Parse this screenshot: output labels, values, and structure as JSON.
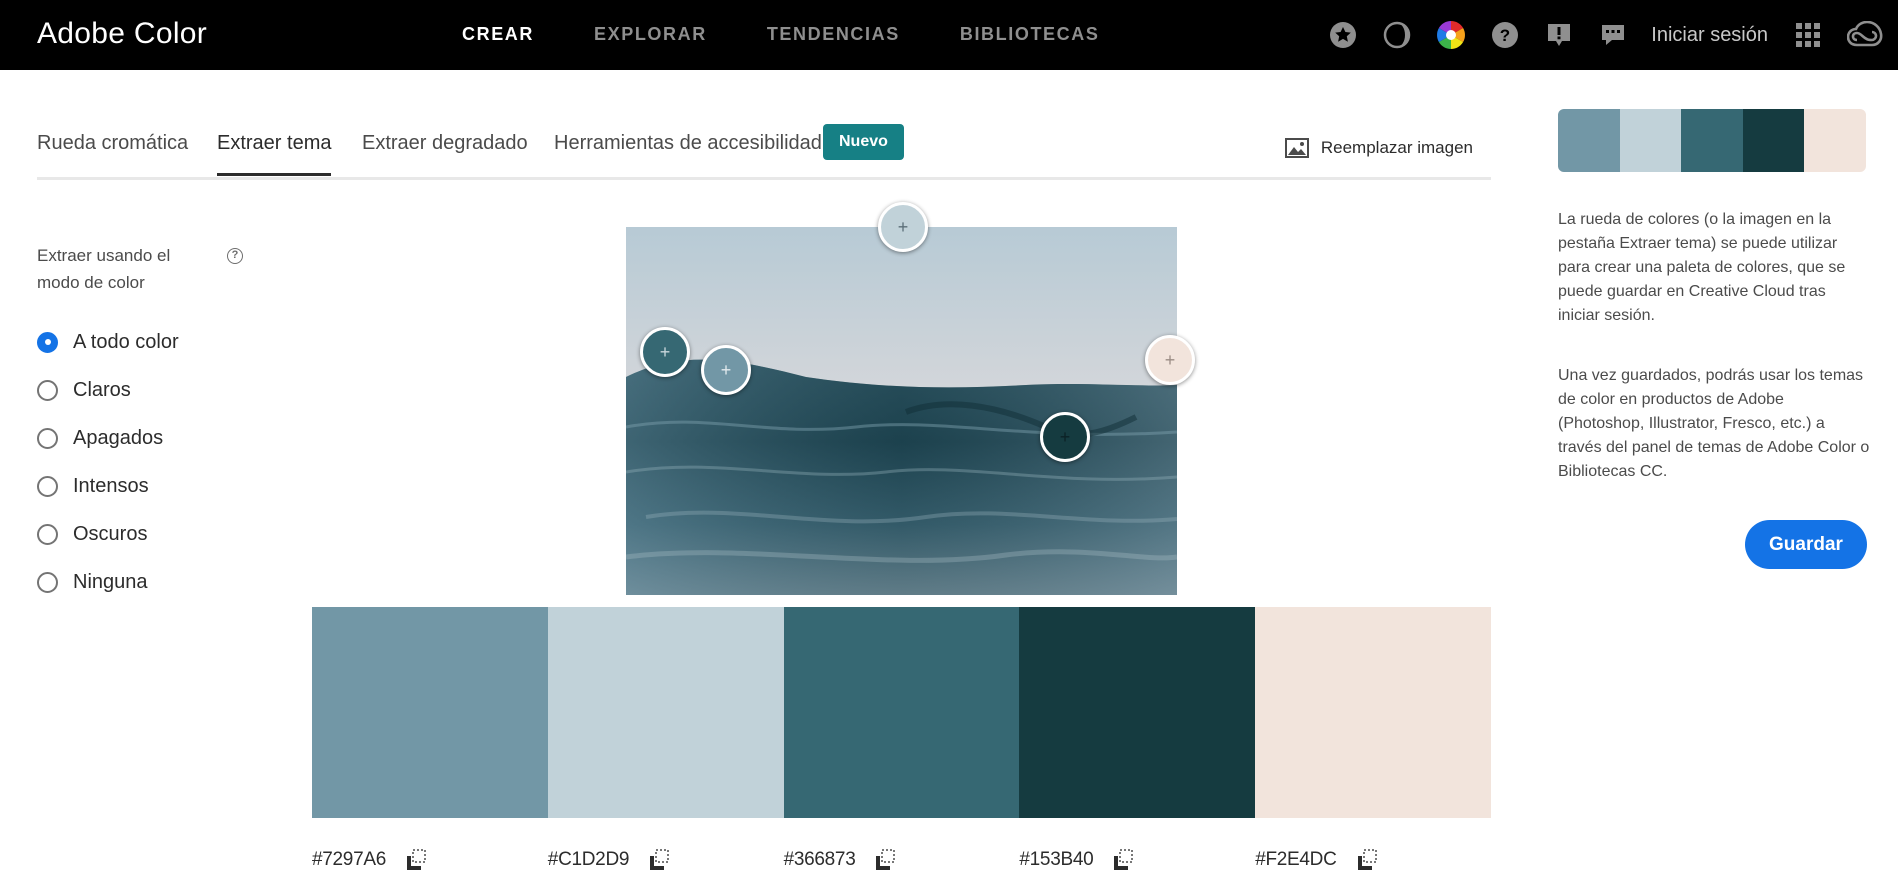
{
  "app": {
    "brand": "Adobe Color"
  },
  "nav": {
    "items": [
      {
        "label": "CREAR",
        "active": true
      },
      {
        "label": "EXPLORAR",
        "active": false
      },
      {
        "label": "TENDENCIAS",
        "active": false
      },
      {
        "label": "BIBLIOTECAS",
        "active": false
      }
    ]
  },
  "header_tools": {
    "icons": [
      "star-icon",
      "moon-icon",
      "color-wheel-icon",
      "help-icon",
      "alert-icon",
      "chat-icon"
    ],
    "signin": "Iniciar sesión",
    "apps_icon": "apps-grid-icon",
    "cc_icon": "creative-cloud-icon"
  },
  "tabs": {
    "items": [
      {
        "label": "Rueda cromática",
        "active": false
      },
      {
        "label": "Extraer tema",
        "active": true
      },
      {
        "label": "Extraer degradado",
        "active": false
      },
      {
        "label": "Herramientas de accesibilidad",
        "active": false
      }
    ],
    "badge": "Nuevo",
    "replace_image": "Reemplazar imagen"
  },
  "mode": {
    "title": "Extraer usando el modo de color",
    "help": "?",
    "options": [
      {
        "label": "A todo color",
        "checked": true
      },
      {
        "label": "Claros",
        "checked": false
      },
      {
        "label": "Apagados",
        "checked": false
      },
      {
        "label": "Intensos",
        "checked": false
      },
      {
        "label": "Oscuros",
        "checked": false
      },
      {
        "label": "Ninguna",
        "checked": false
      }
    ]
  },
  "pickers": [
    {
      "color": "#C1D2D9",
      "symbol": "+"
    },
    {
      "color": "#366873",
      "symbol": "+"
    },
    {
      "color": "#7297A6",
      "symbol": "+"
    },
    {
      "color": "#F2E4DC",
      "symbol": "+"
    },
    {
      "color": "#153B40",
      "symbol": "+"
    }
  ],
  "swatches": [
    {
      "color": "#7297A6",
      "hex": "#7297A6"
    },
    {
      "color": "#C1D2D9",
      "hex": "#C1D2D9"
    },
    {
      "color": "#366873",
      "hex": "#366873"
    },
    {
      "color": "#153B40",
      "hex": "#153B40"
    },
    {
      "color": "#F2E4DC",
      "hex": "#F2E4DC"
    }
  ],
  "info": {
    "p1": "La rueda de colores (o la imagen en la pestaña Extraer tema) se puede utilizar para crear una paleta de colores, que se puede guardar en Creative Cloud tras iniciar sesión.",
    "p2": "Una vez guardados, podrás usar los temas de color en productos de Adobe (Photoshop, Illustrator, Fresco, etc.) a través del panel de temas de Adobe Color o Bibliotecas CC.",
    "save": "Guardar"
  },
  "colors": {
    "accent": "#1473E6",
    "badge": "#168085",
    "topbar": "#000000"
  }
}
